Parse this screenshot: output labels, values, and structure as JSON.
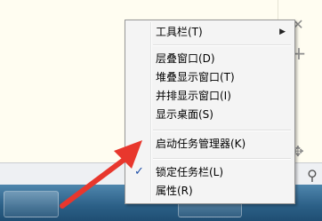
{
  "menu": {
    "items": [
      {
        "label": "工具栏(T)",
        "has_submenu": true,
        "checked": false
      },
      {
        "label": "层叠窗口(D)",
        "has_submenu": false,
        "checked": false
      },
      {
        "label": "堆叠显示窗口(T)",
        "has_submenu": false,
        "checked": false
      },
      {
        "label": "并排显示窗口(I)",
        "has_submenu": false,
        "checked": false
      },
      {
        "label": "显示桌面(S)",
        "has_submenu": false,
        "checked": false
      },
      {
        "label": "启动任务管理器(K)",
        "has_submenu": false,
        "checked": false
      },
      {
        "label": "锁定任务栏(L)",
        "has_submenu": false,
        "checked": true
      },
      {
        "label": "属性(R)",
        "has_submenu": false,
        "checked": false
      }
    ],
    "check_glyph": "✓",
    "submenu_glyph": "▶"
  },
  "side_icons": {
    "close": "✕",
    "add": "+",
    "move": "✥",
    "pin": "⚲"
  },
  "annotation": {
    "arrow_color": "#e8372d"
  }
}
